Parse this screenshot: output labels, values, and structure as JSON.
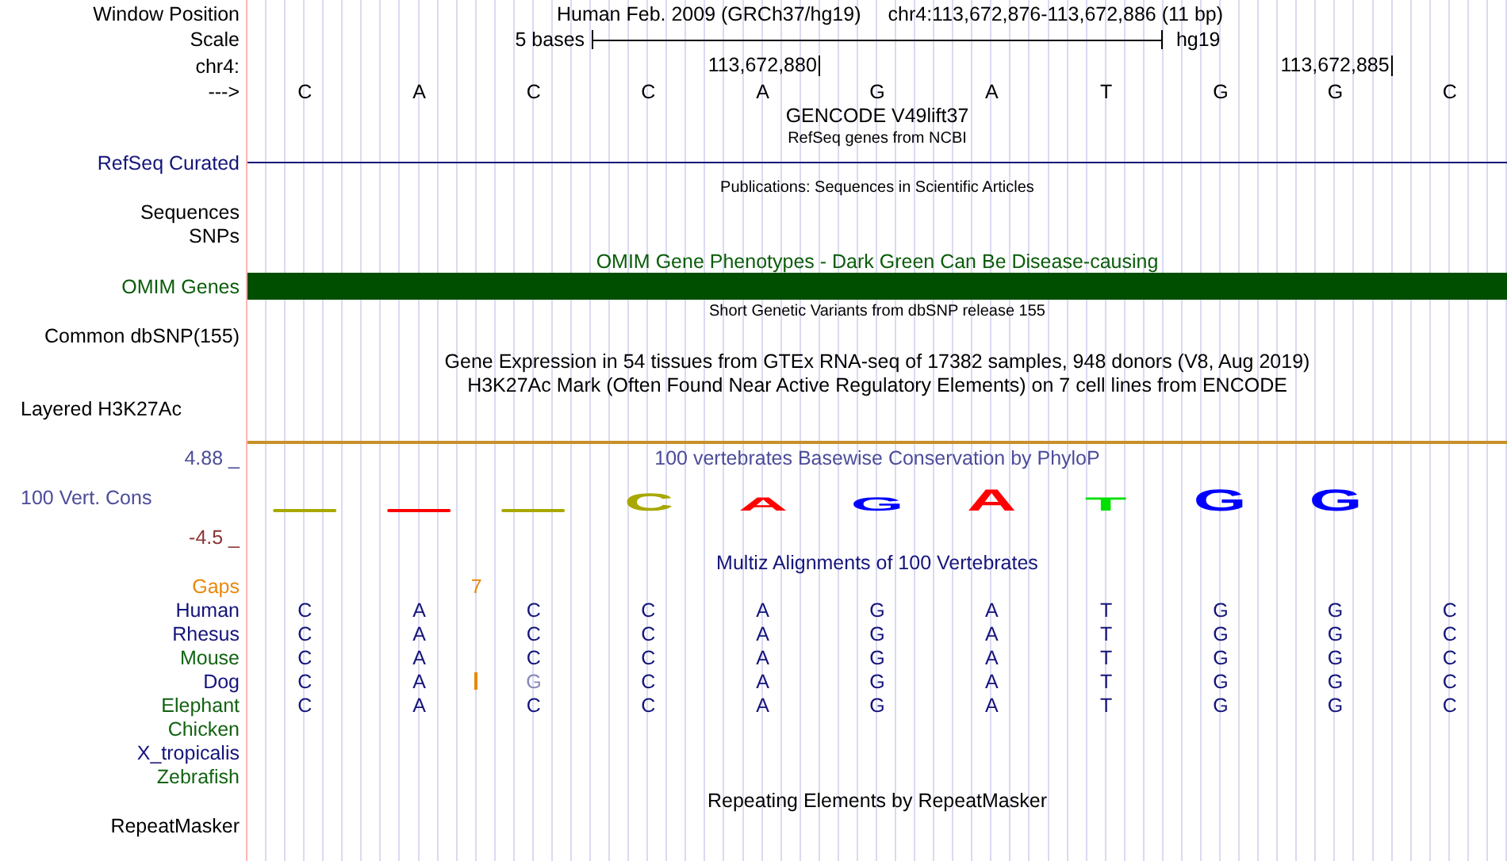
{
  "header": {
    "label": "Window Position",
    "assembly": "Human Feb. 2009 (GRCh37/hg19)",
    "position": "chr4:113,672,876-113,672,886 (11 bp)"
  },
  "scale": {
    "label": "Scale",
    "length": "5 bases",
    "assembly": "hg19"
  },
  "coordinates": {
    "label": "chr4:",
    "ticks": [
      "113,672,880",
      "113,672,885"
    ]
  },
  "sequence": {
    "label": "--->",
    "bases": [
      "C",
      "A",
      "C",
      "C",
      "A",
      "G",
      "A",
      "T",
      "G",
      "G",
      "C"
    ]
  },
  "gencode": {
    "title": "GENCODE V49lift37"
  },
  "refseq": {
    "title": "RefSeq genes from NCBI",
    "label": "RefSeq Curated"
  },
  "publications": {
    "title": "Publications: Sequences in Scientific Articles",
    "labels": [
      "Sequences",
      "SNPs"
    ]
  },
  "omim": {
    "title": "OMIM Gene Phenotypes - Dark Green Can Be Disease-causing",
    "label": "OMIM Genes"
  },
  "dbsnp": {
    "title": "Short Genetic Variants from dbSNP release 155",
    "label": "Common dbSNP(155)"
  },
  "gtex": {
    "title": "Gene Expression in 54 tissues from GTEx RNA-seq of 17382 samples, 948 donors (V8, Aug 2019)"
  },
  "h3k27ac": {
    "title": "H3K27Ac Mark (Often Found Near Active Regulatory Elements) on 7 cell lines from ENCODE",
    "label": "Layered H3K27Ac"
  },
  "conservation": {
    "title": "100 vertebrates Basewise Conservation by PhyloP",
    "label": "100 Vert. Cons",
    "max": "4.88 _",
    "min": "-4.5 _",
    "logo": [
      {
        "kind": "flat",
        "color": "#a8a800"
      },
      {
        "kind": "flat",
        "color": "#ff0000"
      },
      {
        "kind": "flat",
        "color": "#a8a800"
      },
      {
        "kind": "medium",
        "letter": "C",
        "color": "#a8a800"
      },
      {
        "kind": "small",
        "letter": "A",
        "color": "#ff0000"
      },
      {
        "kind": "small",
        "letter": "G",
        "color": "#0000ff"
      },
      {
        "kind": "large",
        "letter": "A",
        "color": "#ff0000"
      },
      {
        "kind": "small",
        "letter": "T",
        "color": "#00e000"
      },
      {
        "kind": "large",
        "letter": "G",
        "color": "#0000ff"
      },
      {
        "kind": "large",
        "letter": "G",
        "color": "#0000ff"
      }
    ]
  },
  "multiz": {
    "title": "Multiz Alignments of 100 Vertebrates",
    "gaps": {
      "label": "Gaps",
      "count": "7"
    },
    "species": [
      {
        "name": "Human",
        "color": "#14147a",
        "bases": [
          {
            "letter": "C",
            "faded": false,
            "gap_before": false
          },
          {
            "letter": "A",
            "faded": false,
            "gap_before": false
          },
          {
            "letter": "C",
            "faded": false,
            "gap_before": false
          },
          {
            "letter": "C",
            "faded": false,
            "gap_before": false
          },
          {
            "letter": "A",
            "faded": false,
            "gap_before": false
          },
          {
            "letter": "G",
            "faded": false,
            "gap_before": false
          },
          {
            "letter": "A",
            "faded": false,
            "gap_before": false
          },
          {
            "letter": "T",
            "faded": false,
            "gap_before": false
          },
          {
            "letter": "G",
            "faded": false,
            "gap_before": false
          },
          {
            "letter": "G",
            "faded": false,
            "gap_before": false
          },
          {
            "letter": "C",
            "faded": false,
            "gap_before": false
          }
        ]
      },
      {
        "name": "Rhesus",
        "color": "#14147a",
        "bases": [
          {
            "letter": "C",
            "faded": false,
            "gap_before": false
          },
          {
            "letter": "A",
            "faded": false,
            "gap_before": false
          },
          {
            "letter": "C",
            "faded": false,
            "gap_before": false
          },
          {
            "letter": "C",
            "faded": false,
            "gap_before": false
          },
          {
            "letter": "A",
            "faded": false,
            "gap_before": false
          },
          {
            "letter": "G",
            "faded": false,
            "gap_before": false
          },
          {
            "letter": "A",
            "faded": false,
            "gap_before": false
          },
          {
            "letter": "T",
            "faded": false,
            "gap_before": false
          },
          {
            "letter": "G",
            "faded": false,
            "gap_before": false
          },
          {
            "letter": "G",
            "faded": false,
            "gap_before": false
          },
          {
            "letter": "C",
            "faded": false,
            "gap_before": false
          }
        ]
      },
      {
        "name": "Mouse",
        "color": "#126312",
        "bases": [
          {
            "letter": "C",
            "faded": false,
            "gap_before": false
          },
          {
            "letter": "A",
            "faded": false,
            "gap_before": false
          },
          {
            "letter": "C",
            "faded": false,
            "gap_before": false
          },
          {
            "letter": "C",
            "faded": false,
            "gap_before": false
          },
          {
            "letter": "A",
            "faded": false,
            "gap_before": false
          },
          {
            "letter": "G",
            "faded": false,
            "gap_before": false
          },
          {
            "letter": "A",
            "faded": false,
            "gap_before": false
          },
          {
            "letter": "T",
            "faded": false,
            "gap_before": false
          },
          {
            "letter": "G",
            "faded": false,
            "gap_before": false
          },
          {
            "letter": "G",
            "faded": false,
            "gap_before": false
          },
          {
            "letter": "C",
            "faded": false,
            "gap_before": false
          }
        ]
      },
      {
        "name": "Dog",
        "color": "#14147a",
        "bases": [
          {
            "letter": "C",
            "faded": false,
            "gap_before": false
          },
          {
            "letter": "A",
            "faded": false,
            "gap_before": false
          },
          {
            "letter": "G",
            "faded": true,
            "gap_before": true
          },
          {
            "letter": "C",
            "faded": false,
            "gap_before": false
          },
          {
            "letter": "A",
            "faded": false,
            "gap_before": false
          },
          {
            "letter": "G",
            "faded": false,
            "gap_before": false
          },
          {
            "letter": "A",
            "faded": false,
            "gap_before": false
          },
          {
            "letter": "T",
            "faded": false,
            "gap_before": false
          },
          {
            "letter": "G",
            "faded": false,
            "gap_before": false
          },
          {
            "letter": "G",
            "faded": false,
            "gap_before": false
          },
          {
            "letter": "C",
            "faded": false,
            "gap_before": false
          }
        ]
      },
      {
        "name": "Elephant",
        "color": "#126312",
        "bases": [
          {
            "letter": "C",
            "faded": false,
            "gap_before": false
          },
          {
            "letter": "A",
            "faded": false,
            "gap_before": false
          },
          {
            "letter": "C",
            "faded": false,
            "gap_before": false
          },
          {
            "letter": "C",
            "faded": false,
            "gap_before": false
          },
          {
            "letter": "A",
            "faded": false,
            "gap_before": false
          },
          {
            "letter": "G",
            "faded": false,
            "gap_before": false
          },
          {
            "letter": "A",
            "faded": false,
            "gap_before": false
          },
          {
            "letter": "T",
            "faded": false,
            "gap_before": false
          },
          {
            "letter": "G",
            "faded": false,
            "gap_before": false
          },
          {
            "letter": "G",
            "faded": false,
            "gap_before": false
          },
          {
            "letter": "C",
            "faded": false,
            "gap_before": false
          }
        ]
      },
      {
        "name": "Chicken",
        "color": "#126312"
      },
      {
        "name": "X_tropicalis",
        "color": "#14147a"
      },
      {
        "name": "Zebrafish",
        "color": "#126312"
      }
    ]
  },
  "repeatmasker": {
    "title": "Repeating Elements by RepeatMasker",
    "label": "RepeatMasker"
  }
}
